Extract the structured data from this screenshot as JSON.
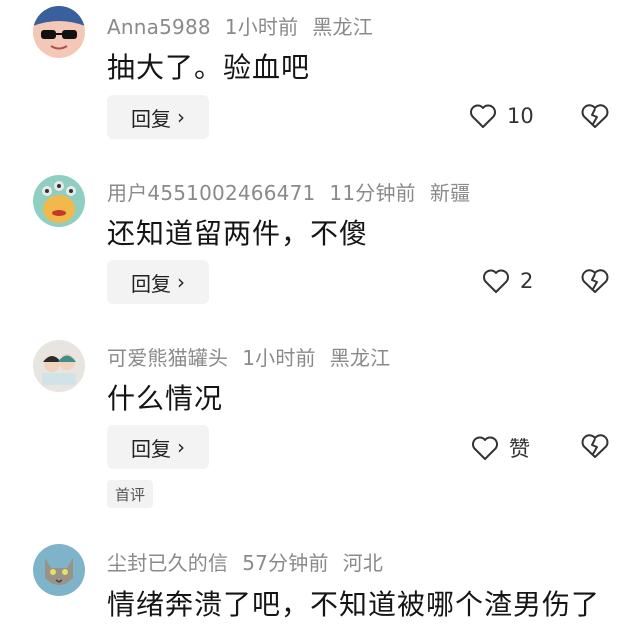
{
  "comments": [
    {
      "username": "Anna5988",
      "time": "1小时前",
      "location": "黑龙江",
      "text": "抽大了。验血吧",
      "reply_label": "回复",
      "like_count": "10",
      "avatar": "avatar-cartoon-sunglasses"
    },
    {
      "username": "用户4551002466471",
      "time": "11分钟前",
      "location": "新疆",
      "text": "还知道留两件，不傻",
      "reply_label": "回复",
      "like_count": "2",
      "avatar": "avatar-green-monster"
    },
    {
      "username": "可爱熊猫罐头",
      "time": "1小时前",
      "location": "黑龙江",
      "text": "什么情况",
      "reply_label": "回复",
      "like_count": "赞",
      "badge": "首评",
      "avatar": "avatar-couple-photo"
    },
    {
      "username": "尘封已久的信",
      "time": "57分钟前",
      "location": "河北",
      "text": "情绪奔溃了吧，不知道被哪个渣男伤了",
      "avatar": "avatar-cat-photo"
    }
  ],
  "icons": {
    "chevron": "chevron-right-icon",
    "like": "heart-outline-icon",
    "dislike": "broken-heart-icon"
  }
}
